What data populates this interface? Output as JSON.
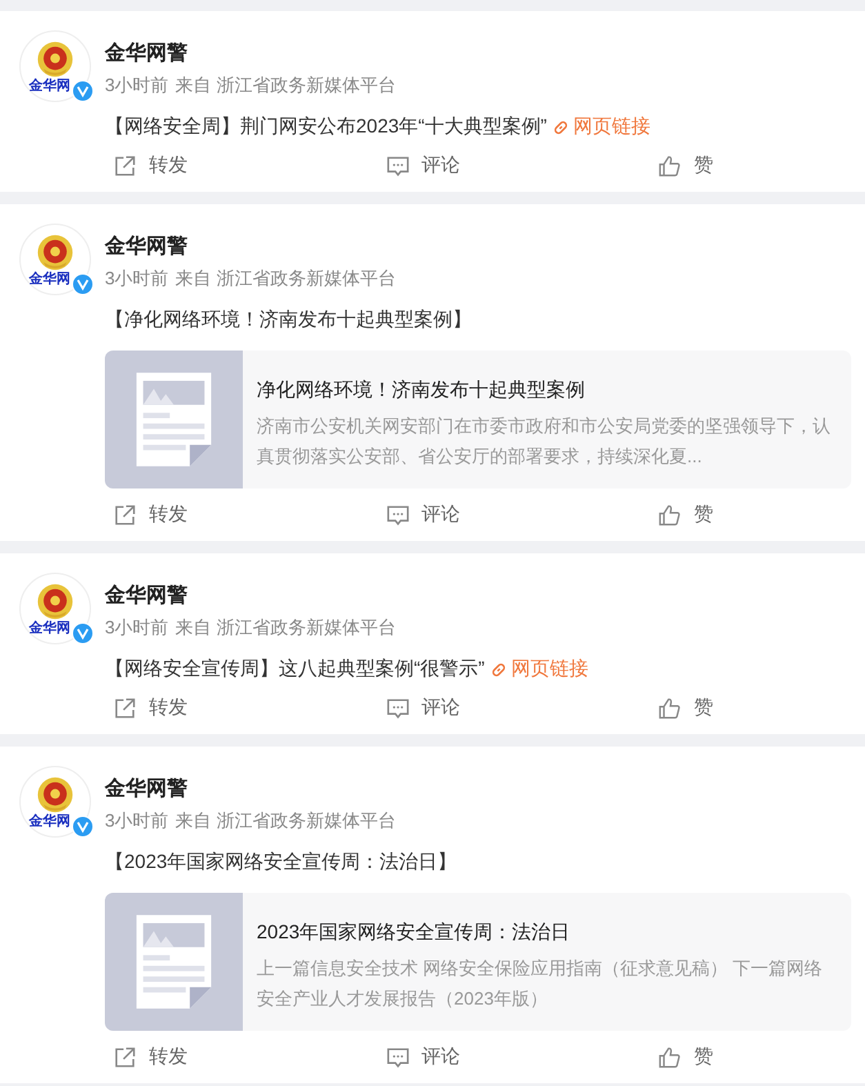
{
  "posts": [
    {
      "author": "金华网警",
      "avatar_text": "金华网",
      "verified": true,
      "time": "3小时前",
      "source": "来自 浙江省政务新媒体平台",
      "content": "【网络安全周】荆门网安公布2023年“十大典型案例”",
      "link": "网页链接",
      "actions": [
        "转发",
        "评论",
        "赞"
      ]
    },
    {
      "author": "金华网警",
      "avatar_text": "金华网",
      "verified": true,
      "time": "3小时前",
      "source": "来自 浙江省政务新媒体平台",
      "content": "【净化网络环境！济南发布十起典型案例】",
      "card": {
        "title": "净化网络环境！济南发布十起典型案例",
        "summary": "济南市公安机关网安部门在市委市政府和市公安局党委的坚强领导下，认真贯彻落实公安部、省公安厅的部署要求，持续深化夏..."
      },
      "actions": [
        "转发",
        "评论",
        "赞"
      ]
    },
    {
      "author": "金华网警",
      "avatar_text": "金华网",
      "verified": true,
      "time": "3小时前",
      "source": "来自 浙江省政务新媒体平台",
      "content": "【网络安全宣传周】这八起典型案例“很警示”",
      "link": "网页链接",
      "actions": [
        "转发",
        "评论",
        "赞"
      ]
    },
    {
      "author": "金华网警",
      "avatar_text": "金华网",
      "verified": true,
      "time": "3小时前",
      "source": "来自 浙江省政务新媒体平台",
      "content": "【2023年国家网络安全宣传周：法治日】",
      "card": {
        "title": "2023年国家网络安全宣传周：法治日",
        "summary": "上一篇信息安全技术 网络安全保险应用指南（征求意见稿） 下一篇网络安全产业人才发展报告（2023年版）"
      },
      "actions": [
        "转发",
        "评论",
        "赞"
      ]
    }
  ]
}
